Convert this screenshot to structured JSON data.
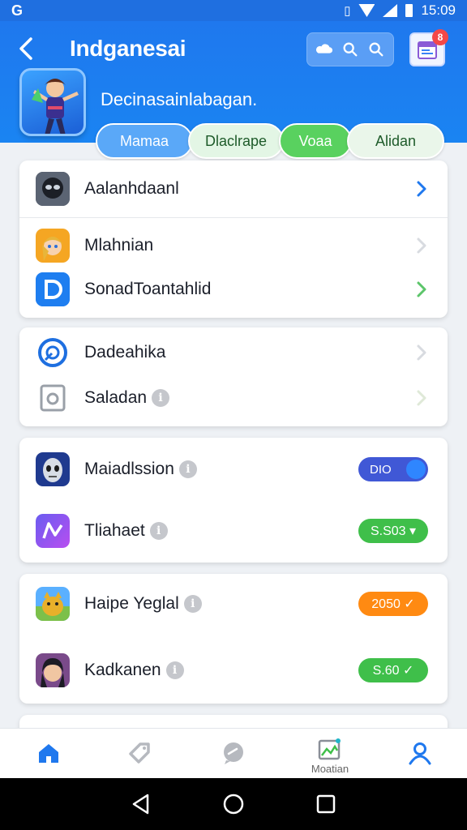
{
  "status_bar": {
    "left_glyph": "G",
    "time": "15:09"
  },
  "header": {
    "title": "Indganesai",
    "subtitle": "Decinasainlabagan.",
    "notification_count": "8"
  },
  "tabs": [
    {
      "label": "Mamaa"
    },
    {
      "label": "Dlaclrape"
    },
    {
      "label": "Voaa"
    },
    {
      "label": "Alidan"
    }
  ],
  "card1": {
    "items": [
      {
        "label": "Aalanhdaanl",
        "icon": "masked-face-icon"
      },
      {
        "label": "Mlahnian",
        "icon": "character-portrait-icon"
      },
      {
        "label": "SonadToantahlid",
        "icon": "d-logo-icon"
      }
    ]
  },
  "card2": {
    "items": [
      {
        "label": "Dadeahika",
        "icon": "circle-logo-icon"
      },
      {
        "label": "Saladan",
        "icon": "camera-frame-icon"
      }
    ]
  },
  "card3": {
    "items": [
      {
        "label": "Maiadlssion",
        "icon": "alien-face-icon",
        "control": "toggle",
        "control_text": "DIO"
      },
      {
        "label": "Tliahaet",
        "icon": "purple-logo-icon",
        "control": "pill",
        "control_text": "S.S03 ▾"
      }
    ]
  },
  "card4": {
    "items": [
      {
        "label": "Haipe Yeglal",
        "icon": "golden-creature-icon",
        "control": "pill",
        "control_text": "2050 ✓"
      },
      {
        "label": "Kadkanen",
        "icon": "dark-hair-portrait-icon",
        "control": "pill",
        "control_text": "S.60 ✓"
      }
    ]
  },
  "bottom_nav": {
    "items": [
      {
        "name": "home",
        "label": ""
      },
      {
        "name": "tag",
        "label": ""
      },
      {
        "name": "chat",
        "label": ""
      },
      {
        "name": "gallery",
        "label": "Moatian"
      },
      {
        "name": "profile",
        "label": ""
      }
    ]
  },
  "colors": {
    "header_blue": "#1f78ee",
    "toggle_blue": "#4058d6",
    "pill_green": "#3fbf4a",
    "pill_orange": "#ff8a12"
  }
}
